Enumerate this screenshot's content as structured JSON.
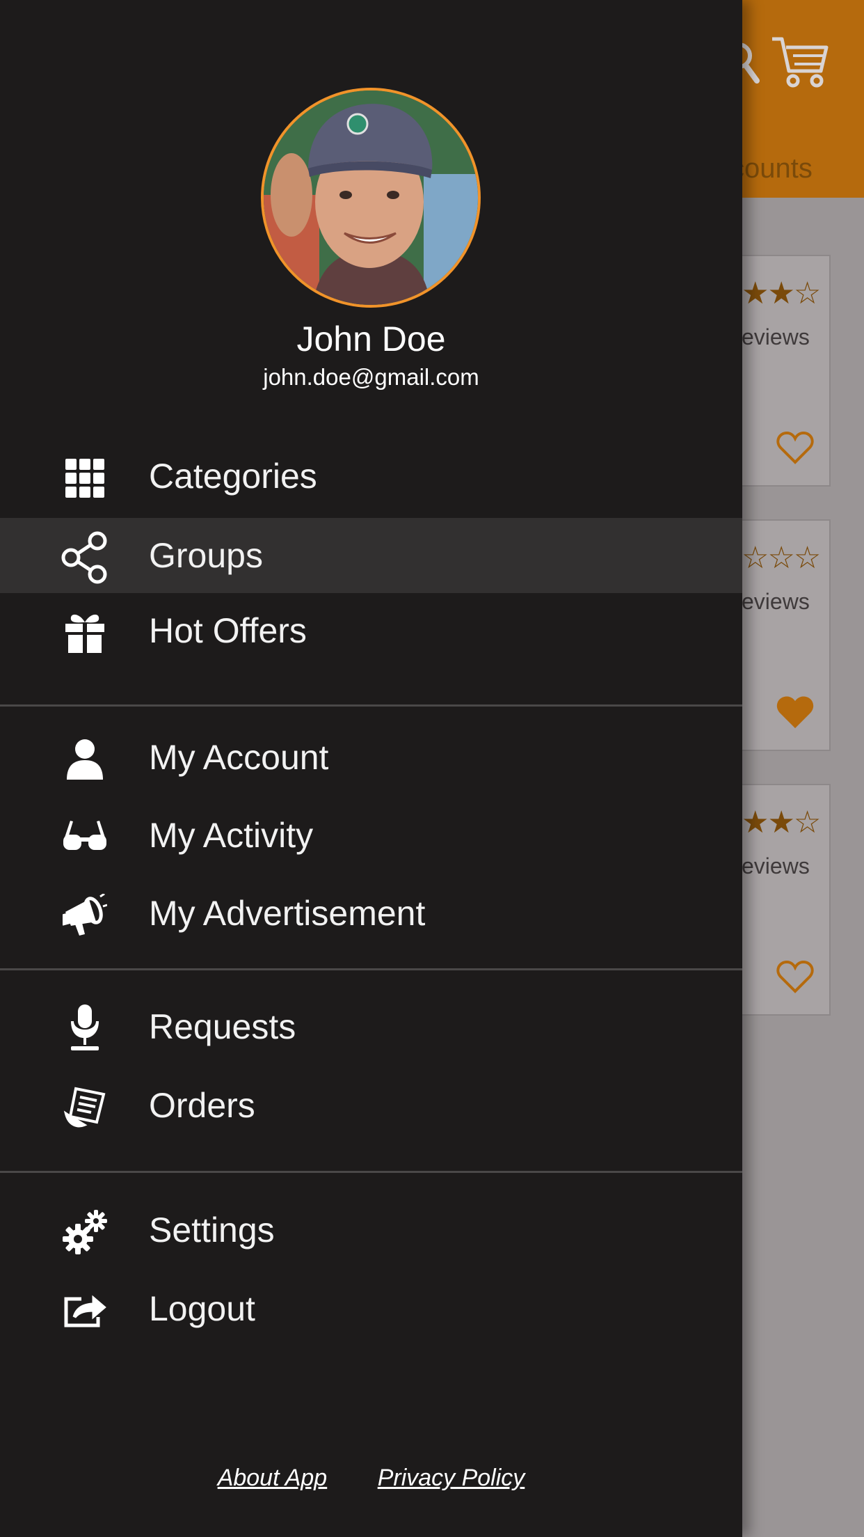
{
  "background": {
    "tab_label": "counts",
    "cards": [
      {
        "stars": "★★☆",
        "reviews": "eviews",
        "favorited": false
      },
      {
        "stars": "☆☆☆",
        "reviews": "eviews",
        "favorited": true
      },
      {
        "stars": "★★☆",
        "reviews": "eviews",
        "favorited": false
      }
    ],
    "header_color": "#b56a0d"
  },
  "profile": {
    "name": "John Doe",
    "email": "john.doe@gmail.com"
  },
  "menu": {
    "items": [
      {
        "label": "Categories",
        "icon": "grid-icon"
      },
      {
        "label": "Groups",
        "icon": "share-icon",
        "active": true
      },
      {
        "label": "Hot Offers",
        "icon": "gift-icon"
      },
      {
        "label": "My Account",
        "icon": "user-icon"
      },
      {
        "label": "My Activity",
        "icon": "glasses-icon"
      },
      {
        "label": "My Advertisement",
        "icon": "megaphone-icon"
      },
      {
        "label": "Requests",
        "icon": "microphone-icon"
      },
      {
        "label": "Orders",
        "icon": "receipt-icon"
      },
      {
        "label": "Settings",
        "icon": "gears-icon"
      },
      {
        "label": "Logout",
        "icon": "logout-icon"
      }
    ]
  },
  "footer": {
    "about_label": "About App",
    "privacy_label": "Privacy Policy"
  },
  "colors": {
    "drawer_bg": "#1d1b1b",
    "active_row": "#323030",
    "avatar_ring": "#f1932a",
    "accent": "#b56a0d"
  }
}
